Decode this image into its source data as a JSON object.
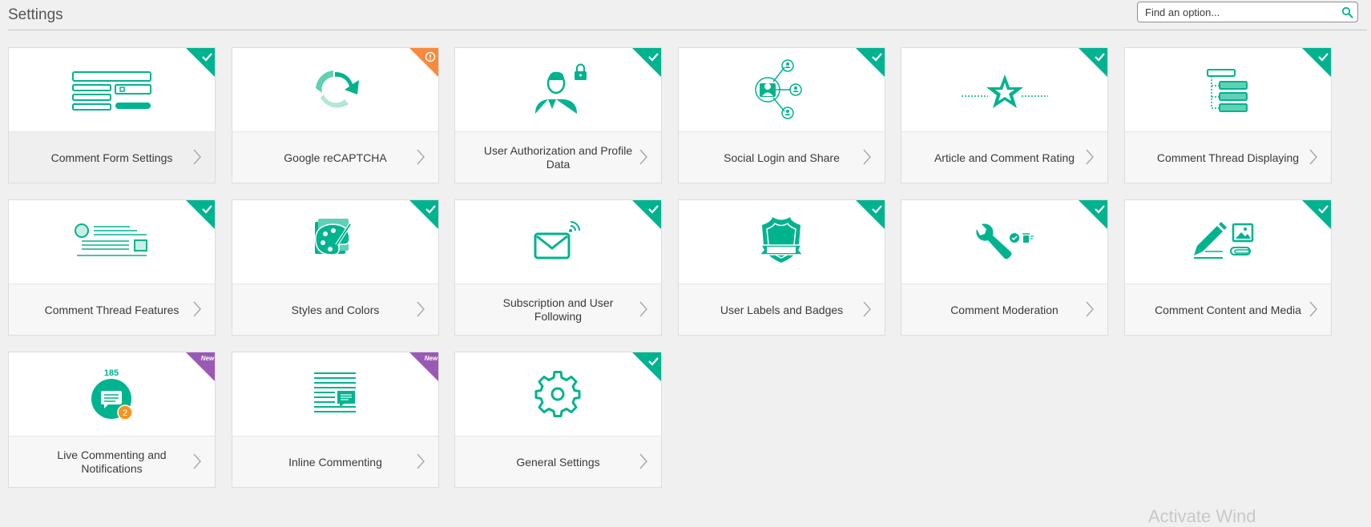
{
  "page": {
    "title": "Settings",
    "search_placeholder": "Find an option...",
    "watermark": "Activate Wind"
  },
  "cards": [
    {
      "label": "Comment Form Settings",
      "badge": "check",
      "icon": "comment-form-icon"
    },
    {
      "label": "Google reCAPTCHA",
      "badge": "warning",
      "icon": "recaptcha-icon"
    },
    {
      "label": "User Authorization and Profile Data",
      "badge": "check",
      "icon": "user-lock-icon"
    },
    {
      "label": "Social Login and Share",
      "badge": "check",
      "icon": "social-network-icon"
    },
    {
      "label": "Article and Comment Rating",
      "badge": "check",
      "icon": "star-rating-icon"
    },
    {
      "label": "Comment Thread Displaying",
      "badge": "check",
      "icon": "thread-tree-icon"
    },
    {
      "label": "Comment Thread Features",
      "badge": "check",
      "icon": "thread-features-icon"
    },
    {
      "label": "Styles and Colors",
      "badge": "check",
      "icon": "palette-icon"
    },
    {
      "label": "Subscription and User Following",
      "badge": "check",
      "icon": "envelope-signal-icon"
    },
    {
      "label": "User Labels and Badges",
      "badge": "check",
      "icon": "shield-badge-icon"
    },
    {
      "label": "Comment Moderation",
      "badge": "check",
      "icon": "wrench-icon"
    },
    {
      "label": "Comment Content and Media",
      "badge": "check",
      "icon": "pencil-media-icon"
    },
    {
      "label": "Live Commenting and Notifications",
      "badge": "new",
      "badge_text": "New",
      "icon": "live-chat-icon",
      "count": "185",
      "notif": "2"
    },
    {
      "label": "Inline Commenting",
      "badge": "new",
      "badge_text": "New",
      "icon": "inline-comment-icon"
    },
    {
      "label": "General Settings",
      "badge": "check",
      "icon": "gear-icon"
    }
  ],
  "colors": {
    "accent": "#00b38f",
    "warning": "#f78a3c",
    "new": "#9b59b6",
    "notif": "#f7931e"
  }
}
